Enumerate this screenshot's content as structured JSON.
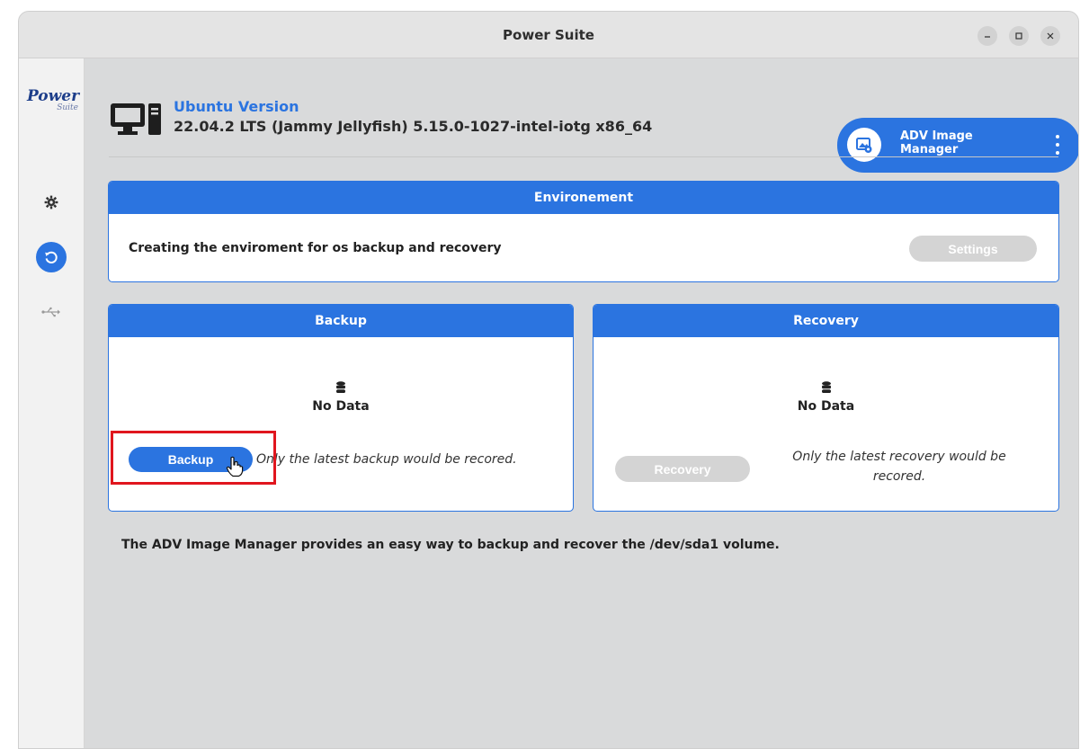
{
  "window": {
    "title": "Power Suite",
    "controls": [
      "minimize",
      "maximize",
      "close"
    ]
  },
  "sidebar": {
    "logo_main": "Power",
    "logo_sub": "Suite",
    "items": [
      {
        "icon": "gear-icon"
      },
      {
        "icon": "recovery-icon",
        "active": true
      },
      {
        "icon": "usb-icon"
      }
    ]
  },
  "header": {
    "version_title": "Ubuntu Version",
    "version_detail": "22.04.2 LTS (Jammy Jellyfish) 5.15.0-1027-intel-iotg x86_64"
  },
  "adv": {
    "label": "ADV Image Manager"
  },
  "environment": {
    "title": "Environement",
    "text": "Creating the enviroment for os backup and recovery",
    "settings_label": "Settings"
  },
  "backup": {
    "title": "Backup",
    "status": "No Data",
    "button_label": "Backup",
    "note": "Only the latest backup would be recored."
  },
  "recovery": {
    "title": "Recovery",
    "status": "No Data",
    "button_label": "Recovery",
    "note": "Only the latest recovery would be recored."
  },
  "footer": {
    "text": "The ADV Image Manager provides an easy way to backup and recover the /dev/sda1 volume."
  },
  "colors": {
    "accent": "#2b74e0",
    "disabled": "#d4d4d4",
    "highlight": "#e0161e"
  }
}
